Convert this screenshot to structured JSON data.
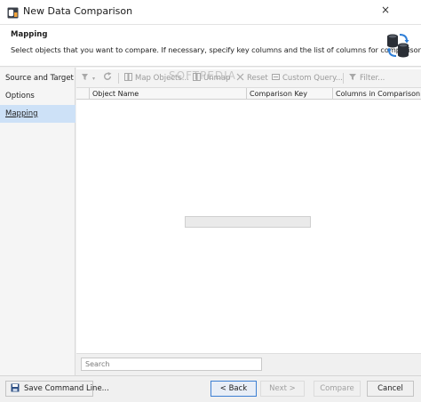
{
  "window": {
    "title": "New Data Comparison",
    "close_glyph": "×",
    "icons": {
      "app": "app-icon",
      "close": "close-icon"
    }
  },
  "header": {
    "title": "Mapping",
    "description": "Select objects that you want to compare. If necessary, specify key columns and the list of columns for comparison.",
    "icon": "database-sync-icon"
  },
  "sidebar": {
    "items": [
      {
        "label": "Source and Target",
        "active": false
      },
      {
        "label": "Options",
        "active": false
      },
      {
        "label": "Mapping",
        "active": true
      }
    ]
  },
  "toolbar": {
    "items": [
      {
        "label": "",
        "icon": "filter-dropdown-icon",
        "enabled": false
      },
      {
        "label": "",
        "icon": "refresh-icon",
        "enabled": false
      },
      {
        "label": "Map Objects...",
        "icon": "map-objects-icon",
        "enabled": false
      },
      {
        "label": "Unmap",
        "icon": "unmap-icon",
        "enabled": false
      },
      {
        "label": "Reset",
        "icon": "reset-icon",
        "enabled": false
      },
      {
        "label": "Custom Query...",
        "icon": "custom-query-icon",
        "enabled": false
      },
      {
        "label": "Filter...",
        "icon": "filter-icon",
        "enabled": false
      }
    ]
  },
  "watermark": "SOFTPEDIA",
  "grid": {
    "columns": [
      "Object Name",
      "Comparison Key",
      "Columns in Comparison"
    ],
    "rows": [],
    "loading_progress": 0
  },
  "search": {
    "placeholder": "Search",
    "value": ""
  },
  "buttons": {
    "save_command_line": "Save Command Line...",
    "back": "< Back",
    "next": "Next >",
    "compare": "Compare",
    "cancel": "Cancel"
  }
}
